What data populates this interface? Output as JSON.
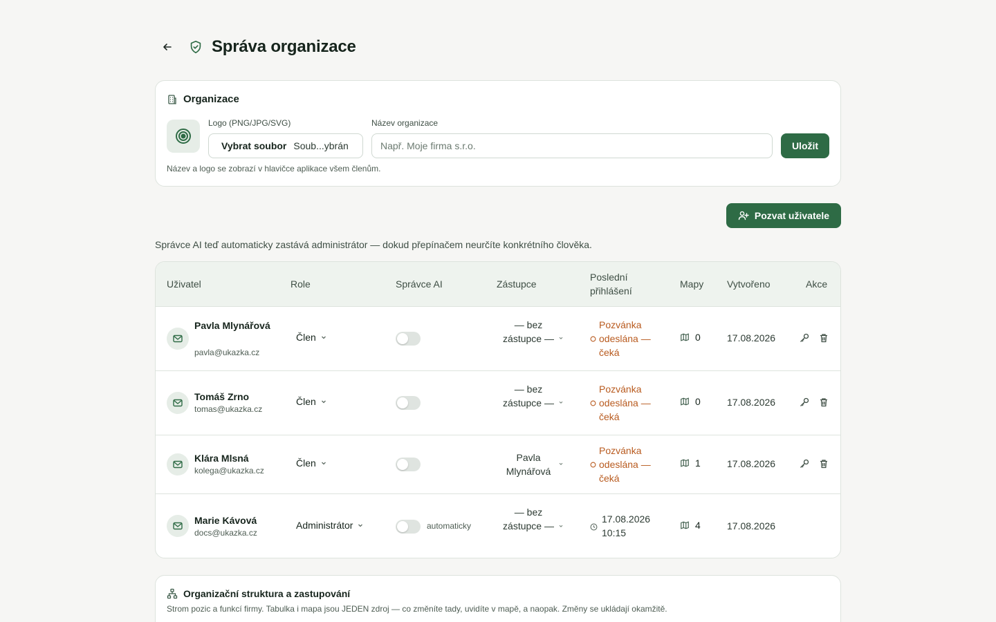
{
  "header": {
    "title": "Správa organizace"
  },
  "organization": {
    "section_title": "Organizace",
    "logo_label": "Logo (PNG/JPG/SVG)",
    "file_button_label": "Vybrat soubor",
    "file_name": "Soub...ybrán",
    "name_label": "Název organizace",
    "name_placeholder": "Např. Moje firma s.r.o.",
    "save_label": "Uložit",
    "hint": "Název a logo se zobrazí v hlavičce aplikace všem členům."
  },
  "invite_label": "Pozvat uživatele",
  "info_text": "Správce AI teď automaticky zastává administrátor — dokud přepínačem neurčíte konkrétního člověka.",
  "table": {
    "headers": {
      "user": "Uživatel",
      "role": "Role",
      "ai_admin": "Správce AI",
      "deputy": "Zástupce",
      "last_login_1": "Poslední",
      "last_login_2": "přihlášení",
      "maps": "Mapy",
      "created": "Vytvořeno",
      "actions": "Akce"
    },
    "rows": [
      {
        "name": "Pavla Mlynářová",
        "email": "pavla@ukazka.cz",
        "role": "Člen",
        "ai_toggle": false,
        "auto_label": "",
        "deputy": "— bez zástupce —",
        "status": "Pozvánka odeslána — čeká",
        "maps": "0",
        "created": "17.08.2026"
      },
      {
        "name": "Tomáš Zrno",
        "email": "tomas@ukazka.cz",
        "role": "Člen",
        "ai_toggle": false,
        "auto_label": "",
        "deputy": "— bez zástupce —",
        "status": "Pozvánka odeslána — čeká",
        "maps": "0",
        "created": "17.08.2026"
      },
      {
        "name": "Klára Mlsná",
        "email": "kolega@ukazka.cz",
        "role": "Člen",
        "ai_toggle": false,
        "auto_label": "",
        "deputy": "Pavla Mlynářová",
        "status": "Pozvánka odeslána — čeká",
        "maps": "1",
        "created": "17.08.2026"
      },
      {
        "name": "Marie Kávová",
        "email": "docs@ukazka.cz",
        "role": "Administrátor",
        "ai_toggle": false,
        "auto_label": "automaticky",
        "deputy": "— bez zástupce —",
        "last_login": "17.08.2026 10:15",
        "maps": "4",
        "created": "17.08.2026"
      }
    ]
  },
  "structure": {
    "title": "Organizační struktura a zastupování",
    "subtitle": "Strom pozic a funkcí firmy. Tabulka i mapa jsou JEDEN zdroj — co změníte tady, uvidíte v mapě, a naopak. Změny se ukládají okamžitě."
  },
  "colors": {
    "accent": "#2e6b45",
    "pending": "#b85a1e",
    "background": "#f6f6f4"
  }
}
